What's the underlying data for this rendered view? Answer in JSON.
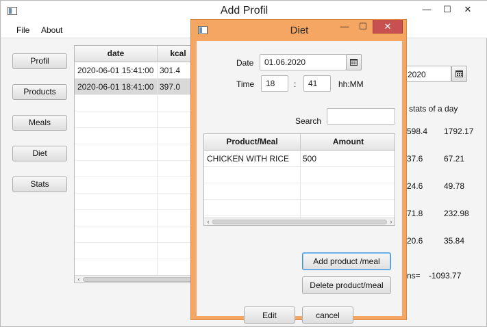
{
  "window": {
    "title": "Add Profil",
    "minimize": "—",
    "maximize": "☐",
    "close": "✕"
  },
  "menu": [
    "File",
    "About"
  ],
  "nav": [
    "Profil",
    "Products",
    "Meals",
    "Diet",
    "Stats"
  ],
  "left_table": {
    "columns": [
      "date",
      "kcal"
    ],
    "rows": [
      [
        "2020-06-01 15:41:00",
        "301.4"
      ],
      [
        "2020-06-01 18:41:00",
        "397.0"
      ]
    ],
    "selected_row": 1
  },
  "right_panel": {
    "date_value": "2020",
    "heading": "stats of a day",
    "rows": [
      [
        "598.4",
        "1792.17"
      ],
      [
        "37.6",
        "67.21"
      ],
      [
        "24.6",
        "49.78"
      ],
      [
        "71.8",
        "232.98"
      ],
      [
        "20.6",
        "35.84"
      ]
    ],
    "sum_label": "ns=",
    "sum_value": "-1093.77"
  },
  "dialog": {
    "title": "Diet",
    "minimize": "—",
    "maximize": "☐",
    "close": "✕",
    "date_label": "Date",
    "date_value": "01.06.2020",
    "time_label": "Time",
    "hour": "18",
    "colon": ":",
    "minute": "41",
    "time_format": "hh:MM",
    "search_label": "Search",
    "search_value": "",
    "table": {
      "columns": [
        "Product/Meal",
        "Amount"
      ],
      "rows": [
        [
          "CHICKEN WITH RICE",
          "500"
        ]
      ]
    },
    "add_button": "Add product /meal",
    "delete_button": "Delete product/meal",
    "edit_button": "Edit",
    "cancel_button": "cancel"
  },
  "icons": {
    "calendar": "calendar-icon",
    "app": "app-icon"
  }
}
